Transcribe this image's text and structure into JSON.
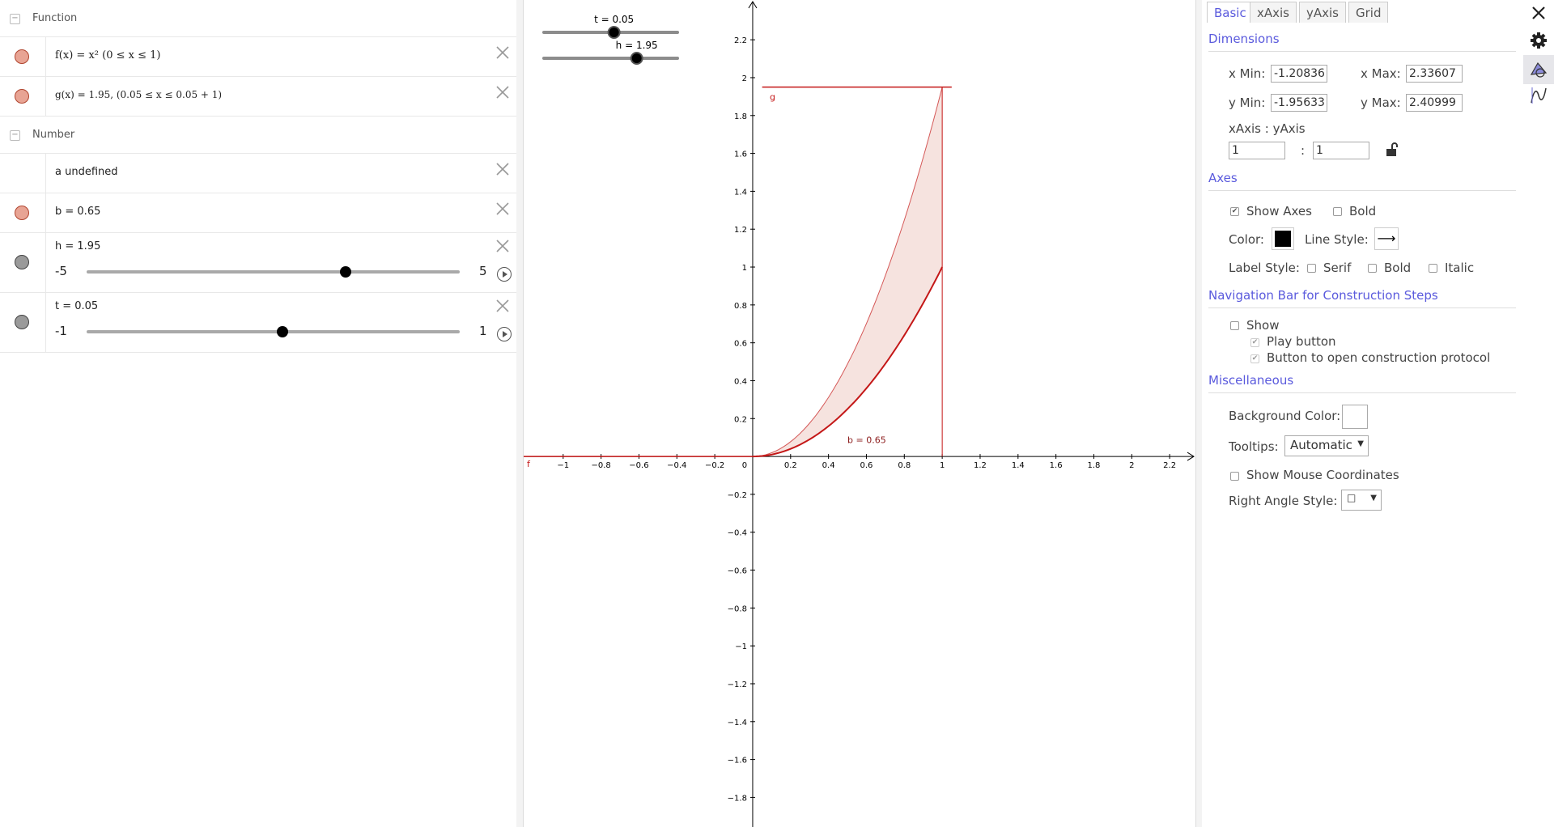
{
  "algebra": {
    "groups": {
      "function": "Function",
      "number": "Number"
    },
    "rows": {
      "f": {
        "text": "f(x) = x² (0 ≤ x ≤ 1)"
      },
      "g": {
        "text": "g(x) = 1.95,   (0.05 ≤ x ≤ 0.05 + 1)"
      },
      "a": {
        "text": "a undefined"
      },
      "b": {
        "text": "b = 0.65"
      },
      "h": {
        "text": "h = 1.95",
        "min": "-5",
        "max": "5",
        "value": 1.95,
        "range": [
          -5,
          5
        ]
      },
      "t": {
        "text": "t = 0.05",
        "min": "-1",
        "max": "1",
        "value": 0.05,
        "range": [
          -1,
          1
        ]
      }
    },
    "colors": {
      "function_dot": "#e8a494",
      "slider_dot": "#9a9a9a"
    }
  },
  "graphics": {
    "sliders": {
      "t": {
        "label": "t = 0.05",
        "value": 0.05,
        "range": [
          -1,
          1
        ]
      },
      "h": {
        "label": "h = 1.95",
        "value": 1.95,
        "range": [
          -5,
          5
        ]
      }
    },
    "x_range": [
      -1.20836,
      2.33607
    ],
    "y_range": [
      -1.95633,
      2.40999
    ],
    "x_ticks": [
      "−1",
      "−0.8",
      "−0.6",
      "−0.4",
      "−0.2",
      "0",
      "0.2",
      "0.4",
      "0.6",
      "0.8",
      "1",
      "1.2",
      "1.4",
      "1.6",
      "1.8",
      "2",
      "2.2"
    ],
    "y_ticks": [
      "2.2",
      "2",
      "1.8",
      "1.6",
      "1.4",
      "1.2",
      "1",
      "0.8",
      "0.6",
      "0.4",
      "0.2",
      "−0.2",
      "−0.4",
      "−0.6",
      "−0.8",
      "−1",
      "−1.2",
      "−1.4",
      "−1.6",
      "−1.8"
    ],
    "labels": {
      "f": "f",
      "g": "g",
      "b": "b = 0.65"
    },
    "colors": {
      "curve": "#c41717",
      "fill": "#f6e3df",
      "axes": "#000000"
    }
  },
  "props": {
    "tabs": [
      "Basic",
      "xAxis",
      "yAxis",
      "Grid"
    ],
    "sections": {
      "dimensions": "Dimensions",
      "axes": "Axes",
      "navigation": "Navigation Bar for Construction Steps",
      "misc": "Miscellaneous"
    },
    "dims": {
      "xmin_label": "x Min:",
      "xmin": "-1.20836",
      "xmax_label": "x Max:",
      "xmax": "2.33607",
      "ymin_label": "y Min:",
      "ymin": "-1.95633",
      "ymax_label": "y Max:",
      "ymax": "2.40999",
      "ratio_label": "xAxis : yAxis",
      "ratio_x": "1",
      "ratio_sep": ":",
      "ratio_y": "1"
    },
    "axes": {
      "show_axes": "Show Axes",
      "bold": "Bold",
      "color": "Color:",
      "line_style": "Line Style:",
      "line_style_value": "⟶",
      "label_style": "Label Style:",
      "serif": "Serif",
      "label_bold": "Bold",
      "italic": "Italic",
      "axis_color": "#000000"
    },
    "nav": {
      "show": "Show",
      "play": "Play button",
      "protocol": "Button to open construction protocol"
    },
    "misc": {
      "bg_color": "Background Color:",
      "tooltips": "Tooltips:",
      "tooltips_value": "Automatic",
      "mouse_coords": "Show Mouse Coordinates",
      "right_angle": "Right Angle Style:",
      "right_angle_value": "□"
    },
    "accent": "#5a5add"
  }
}
